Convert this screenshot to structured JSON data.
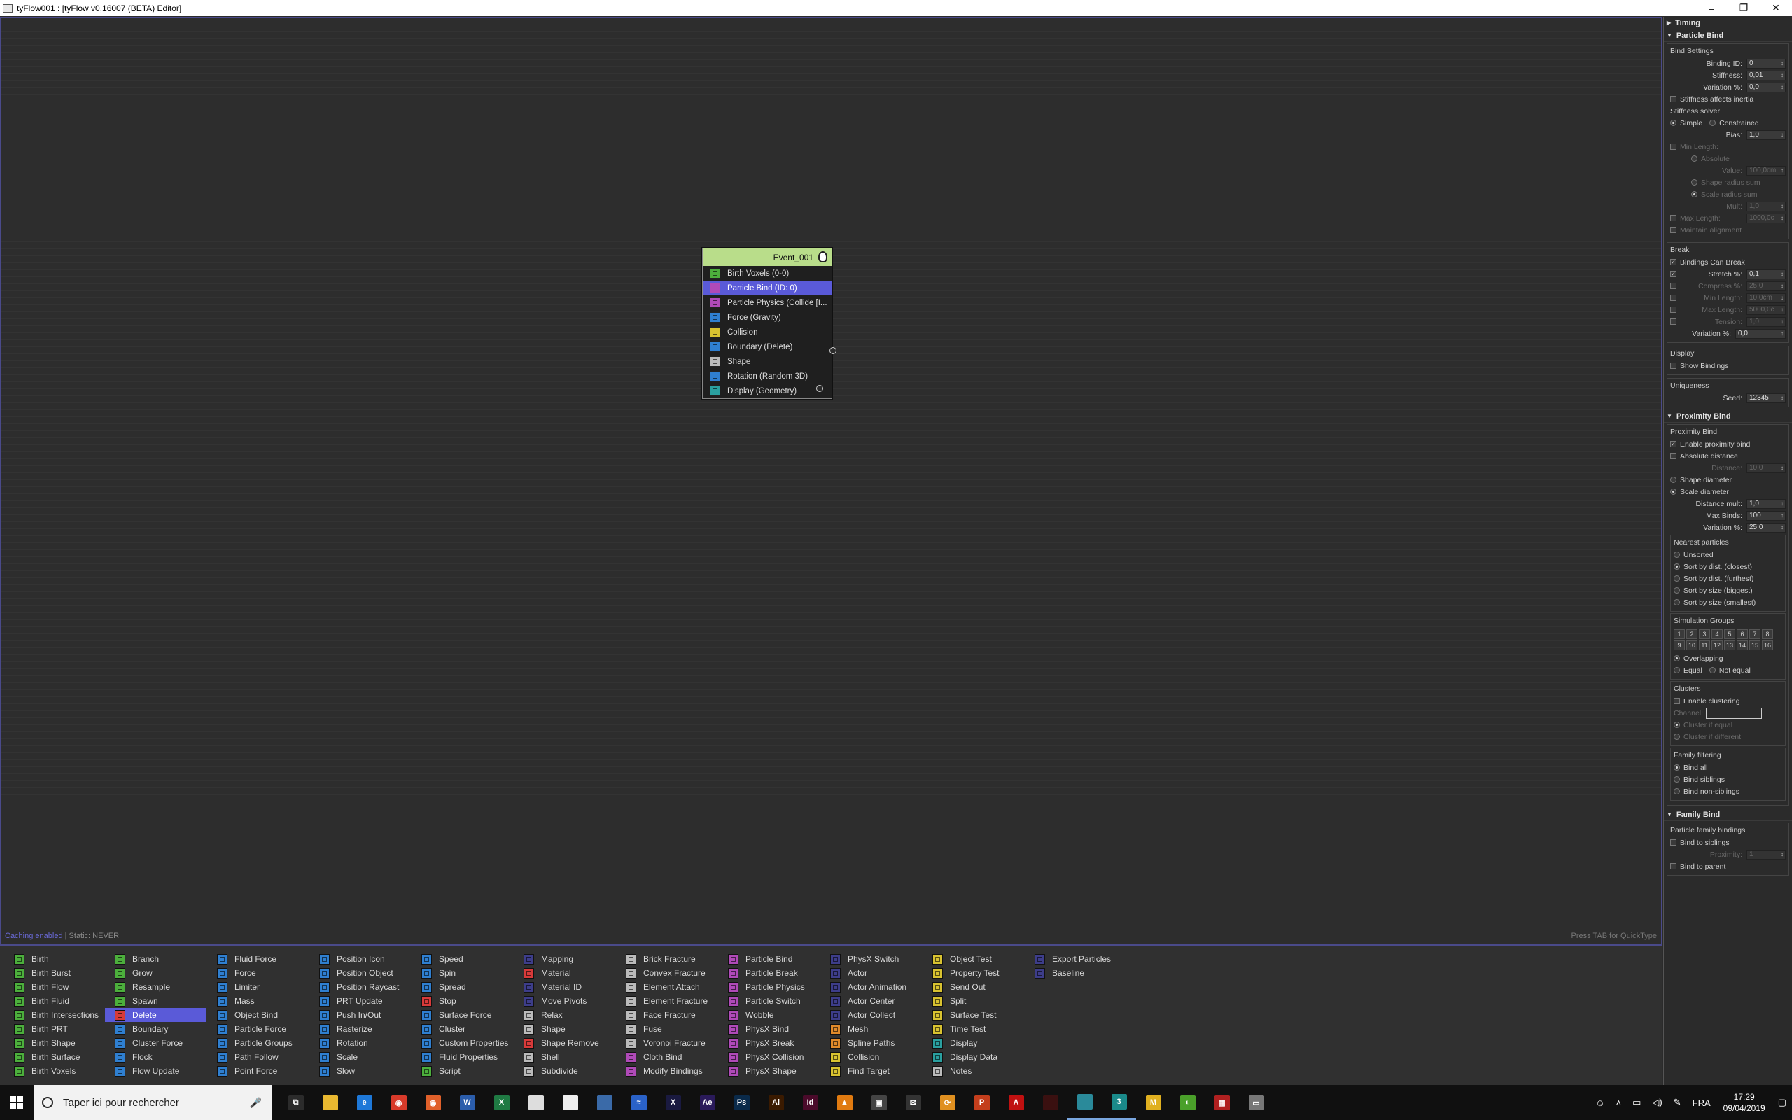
{
  "window": {
    "title": "tyFlow001 : [tyFlow v0,16007 (BETA) Editor]",
    "controls": [
      "–",
      "❐",
      "✕"
    ]
  },
  "canvas": {
    "status_caching": "Caching enabled",
    "status_static": " | Static: NEVER",
    "hint": "Press TAB for QuickType"
  },
  "event": {
    "name": "Event_001",
    "operators": [
      {
        "label": "Birth Voxels (0-0)",
        "color": "c-g",
        "icon": "birth-icon"
      },
      {
        "label": "Particle Bind (ID: 0)",
        "color": "c-p",
        "icon": "bind-icon",
        "selected": true
      },
      {
        "label": "Particle Physics (Collide [I...",
        "color": "c-p",
        "icon": "physics-icon"
      },
      {
        "label": "Force (Gravity)",
        "color": "c-b",
        "icon": "force-icon"
      },
      {
        "label": "Collision",
        "color": "c-y",
        "icon": "collision-icon"
      },
      {
        "label": "Boundary (Delete)",
        "color": "c-b",
        "icon": "boundary-icon"
      },
      {
        "label": "Shape",
        "color": "c-w",
        "icon": "shape-icon"
      },
      {
        "label": "Rotation (Random 3D)",
        "color": "c-b",
        "icon": "rotation-icon"
      },
      {
        "label": "Display (Geometry)",
        "color": "c-t",
        "icon": "display-icon"
      }
    ]
  },
  "rollouts": {
    "timing": "Timing",
    "particle_bind": "Particle Bind",
    "proximity_bind": "Proximity Bind",
    "family_bind": "Family Bind"
  },
  "pb": {
    "bind_settings": "Bind Settings",
    "binding_id_label": "Binding ID:",
    "binding_id": "0",
    "stiffness_label": "Stiffness:",
    "stiffness": "0,01",
    "variation_label": "Variation %:",
    "variation": "0,0",
    "stiffness_inertia": "Stiffness affects inertia",
    "stiffness_solver": "Stiffness solver",
    "simple": "Simple",
    "constrained": "Constrained",
    "bias_label": "Bias:",
    "bias": "1,0",
    "min_length": "Min Length:",
    "absolute": "Absolute",
    "value_label": "Value:",
    "value": "100,0cm",
    "shape_radius_sum": "Shape radius sum",
    "scale_radius_sum": "Scale radius sum",
    "mult_label": "Mult:",
    "mult": "1,0",
    "max_length_label": "Max Length:",
    "max_length": "1000,0c",
    "maintain_alignment": "Maintain alignment",
    "break": "Break",
    "bindings_can_break": "Bindings Can Break",
    "stretch_label": "Stretch %:",
    "stretch": "0,1",
    "compress_label": "Compress %:",
    "compress": "25,0",
    "minl_label": "Min Length:",
    "minl": "10,0cm",
    "maxl_label": "Max Length:",
    "maxl": "5000,0c",
    "tension_label": "Tension:",
    "tension": "1,0",
    "variation2_label": "Variation %:",
    "variation2": "0,0",
    "display": "Display",
    "show_bindings": "Show Bindings",
    "uniqueness": "Uniqueness",
    "seed_label": "Seed:",
    "seed": "12345"
  },
  "prox": {
    "group": "Proximity Bind",
    "enable": "Enable proximity bind",
    "absolute_distance": "Absolute distance",
    "distance_label": "Distance:",
    "distance": "10,0",
    "shape_diameter": "Shape diameter",
    "scale_diameter": "Scale diameter",
    "dist_mult_label": "Distance mult:",
    "dist_mult": "1,0",
    "max_binds_label": "Max Binds:",
    "max_binds": "100",
    "variation_label": "Variation %:",
    "variation": "25,0",
    "nearest": "Nearest particles",
    "unsorted": "Unsorted",
    "sort_closest": "Sort by dist. (closest)",
    "sort_furthest": "Sort by dist. (furthest)",
    "sort_biggest": "Sort by size (biggest)",
    "sort_smallest": "Sort by size (smallest)",
    "sim_groups": "Simulation Groups",
    "groups": [
      "1",
      "2",
      "3",
      "4",
      "5",
      "6",
      "7",
      "8",
      "9",
      "10",
      "11",
      "12",
      "13",
      "14",
      "15",
      "16"
    ],
    "overlapping": "Overlapping",
    "equal": "Equal",
    "not_equal": "Not equal",
    "clusters": "Clusters",
    "enable_clustering": "Enable clustering",
    "channel_label": "Channel:",
    "cluster_equal": "Cluster if equal",
    "cluster_different": "Cluster if different",
    "family_filtering": "Family filtering",
    "bind_all": "Bind all",
    "bind_siblings": "Bind siblings",
    "bind_non_siblings": "Bind non-siblings"
  },
  "family": {
    "group": "Particle family bindings",
    "bind_to_siblings": "Bind to siblings",
    "proximity_label": "Proximity:",
    "proximity": "1",
    "bind_to_parent": "Bind to parent"
  },
  "palette": [
    [
      {
        "l": "Birth",
        "c": "c-g"
      },
      {
        "l": "Birth Burst",
        "c": "c-g"
      },
      {
        "l": "Birth Flow",
        "c": "c-g"
      },
      {
        "l": "Birth Fluid",
        "c": "c-g"
      },
      {
        "l": "Birth Intersections",
        "c": "c-g"
      },
      {
        "l": "Birth PRT",
        "c": "c-g"
      },
      {
        "l": "Birth Shape",
        "c": "c-g"
      },
      {
        "l": "Birth Surface",
        "c": "c-g"
      },
      {
        "l": "Birth Voxels",
        "c": "c-g"
      }
    ],
    [
      {
        "l": "Branch",
        "c": "c-g"
      },
      {
        "l": "Grow",
        "c": "c-g"
      },
      {
        "l": "Resample",
        "c": "c-g"
      },
      {
        "l": "Spawn",
        "c": "c-g"
      },
      {
        "l": "Delete",
        "c": "c-r",
        "sel": true
      },
      {
        "l": "Boundary",
        "c": "c-b"
      },
      {
        "l": "Cluster Force",
        "c": "c-b"
      },
      {
        "l": "Flock",
        "c": "c-b"
      },
      {
        "l": "Flow Update",
        "c": "c-b"
      }
    ],
    [
      {
        "l": "Fluid Force",
        "c": "c-b"
      },
      {
        "l": "Force",
        "c": "c-b"
      },
      {
        "l": "Limiter",
        "c": "c-b"
      },
      {
        "l": "Mass",
        "c": "c-b"
      },
      {
        "l": "Object Bind",
        "c": "c-b"
      },
      {
        "l": "Particle Force",
        "c": "c-b"
      },
      {
        "l": "Particle Groups",
        "c": "c-b"
      },
      {
        "l": "Path Follow",
        "c": "c-b"
      },
      {
        "l": "Point Force",
        "c": "c-b"
      }
    ],
    [
      {
        "l": "Position Icon",
        "c": "c-b"
      },
      {
        "l": "Position Object",
        "c": "c-b"
      },
      {
        "l": "Position Raycast",
        "c": "c-b"
      },
      {
        "l": "PRT Update",
        "c": "c-b"
      },
      {
        "l": "Push In/Out",
        "c": "c-b"
      },
      {
        "l": "Rasterize",
        "c": "c-b"
      },
      {
        "l": "Rotation",
        "c": "c-b"
      },
      {
        "l": "Scale",
        "c": "c-b"
      },
      {
        "l": "Slow",
        "c": "c-b"
      }
    ],
    [
      {
        "l": "Speed",
        "c": "c-b"
      },
      {
        "l": "Spin",
        "c": "c-b"
      },
      {
        "l": "Spread",
        "c": "c-b"
      },
      {
        "l": "Stop",
        "c": "c-r"
      },
      {
        "l": "Surface Force",
        "c": "c-b"
      },
      {
        "l": "Cluster",
        "c": "c-b"
      },
      {
        "l": "Custom Properties",
        "c": "c-b"
      },
      {
        "l": "Fluid Properties",
        "c": "c-b"
      },
      {
        "l": "Script",
        "c": "c-g"
      }
    ],
    [
      {
        "l": "Mapping",
        "c": "c-n"
      },
      {
        "l": "Material",
        "c": "c-r"
      },
      {
        "l": "Material ID",
        "c": "c-n"
      },
      {
        "l": "Move Pivots",
        "c": "c-n"
      },
      {
        "l": "Relax",
        "c": "c-w"
      },
      {
        "l": "Shape",
        "c": "c-w"
      },
      {
        "l": "Shape Remove",
        "c": "c-r"
      },
      {
        "l": "Shell",
        "c": "c-w"
      },
      {
        "l": "Subdivide",
        "c": "c-w"
      }
    ],
    [
      {
        "l": "Brick Fracture",
        "c": "c-w"
      },
      {
        "l": "Convex Fracture",
        "c": "c-w"
      },
      {
        "l": "Element Attach",
        "c": "c-w"
      },
      {
        "l": "Element Fracture",
        "c": "c-w"
      },
      {
        "l": "Face Fracture",
        "c": "c-w"
      },
      {
        "l": "Fuse",
        "c": "c-w"
      },
      {
        "l": "Voronoi Fracture",
        "c": "c-w"
      },
      {
        "l": "Cloth Bind",
        "c": "c-p"
      },
      {
        "l": "Modify Bindings",
        "c": "c-p"
      }
    ],
    [
      {
        "l": "Particle Bind",
        "c": "c-p"
      },
      {
        "l": "Particle Break",
        "c": "c-p"
      },
      {
        "l": "Particle Physics",
        "c": "c-p"
      },
      {
        "l": "Particle Switch",
        "c": "c-p"
      },
      {
        "l": "Wobble",
        "c": "c-p"
      },
      {
        "l": "PhysX Bind",
        "c": "c-p"
      },
      {
        "l": "PhysX Break",
        "c": "c-p"
      },
      {
        "l": "PhysX Collision",
        "c": "c-p"
      },
      {
        "l": "PhysX Shape",
        "c": "c-p"
      }
    ],
    [
      {
        "l": "PhysX Switch",
        "c": "c-n"
      },
      {
        "l": "Actor",
        "c": "c-n"
      },
      {
        "l": "Actor Animation",
        "c": "c-n"
      },
      {
        "l": "Actor Center",
        "c": "c-n"
      },
      {
        "l": "Actor Collect",
        "c": "c-n"
      },
      {
        "l": "Mesh",
        "c": "c-o"
      },
      {
        "l": "Spline Paths",
        "c": "c-o"
      },
      {
        "l": "Collision",
        "c": "c-y"
      },
      {
        "l": "Find Target",
        "c": "c-y"
      }
    ],
    [
      {
        "l": "Object Test",
        "c": "c-y"
      },
      {
        "l": "Property Test",
        "c": "c-y"
      },
      {
        "l": "Send Out",
        "c": "c-y"
      },
      {
        "l": "Split",
        "c": "c-y"
      },
      {
        "l": "Surface Test",
        "c": "c-y"
      },
      {
        "l": "Time Test",
        "c": "c-y"
      },
      {
        "l": "Display",
        "c": "c-t"
      },
      {
        "l": "Display Data",
        "c": "c-t"
      },
      {
        "l": "Notes",
        "c": "c-w"
      }
    ],
    [
      {
        "l": "Export Particles",
        "c": "c-n"
      },
      {
        "l": "Baseline",
        "c": "c-n"
      }
    ]
  ],
  "taskbar": {
    "search_placeholder": "Taper ici pour rechercher",
    "apps": [
      {
        "name": "task-view-app",
        "c": "#2b2b2b",
        "t": "⧉"
      },
      {
        "name": "file-explorer-app",
        "c": "#e8b830",
        "t": ""
      },
      {
        "name": "edge-app",
        "c": "#1e78d8",
        "t": "e"
      },
      {
        "name": "chrome-app",
        "c": "#d83a2a",
        "t": "◉"
      },
      {
        "name": "firefox-app",
        "c": "#e0602a",
        "t": "◉"
      },
      {
        "name": "word-app",
        "c": "#2b5dab",
        "t": "W"
      },
      {
        "name": "excel-app",
        "c": "#1f7a43",
        "t": "X"
      },
      {
        "name": "notepad-app",
        "c": "#ddd",
        "t": ""
      },
      {
        "name": "document-app",
        "c": "#eee",
        "t": ""
      },
      {
        "name": "tool-app",
        "c": "#3a6aa8",
        "t": ""
      },
      {
        "name": "blue-app",
        "c": "#2a62c8",
        "t": "≈"
      },
      {
        "name": "xsplit-app",
        "c": "#1a1a40",
        "t": "X"
      },
      {
        "name": "after-effects-app",
        "c": "#2a1a5a",
        "t": "Ae"
      },
      {
        "name": "photoshop-app",
        "c": "#0a2a4a",
        "t": "Ps"
      },
      {
        "name": "illustrator-app",
        "c": "#3a1a00",
        "t": "Ai"
      },
      {
        "name": "indesign-app",
        "c": "#4a0a2a",
        "t": "Id"
      },
      {
        "name": "vlc-app",
        "c": "#e07a10",
        "t": "▲"
      },
      {
        "name": "photos-app",
        "c": "#444",
        "t": "▣"
      },
      {
        "name": "mail-app",
        "c": "#333",
        "t": "✉"
      },
      {
        "name": "sync-app",
        "c": "#e09020",
        "t": "⟳"
      },
      {
        "name": "powerpoint-app",
        "c": "#c43e1c",
        "t": "P"
      },
      {
        "name": "acrobat-app",
        "c": "#c01010",
        "t": "A"
      },
      {
        "name": "dark-app",
        "c": "#3a1010",
        "t": ""
      },
      {
        "name": "tyflow-app",
        "c": "#2a8a9a",
        "t": "",
        "active": true
      },
      {
        "name": "3dsmax-app",
        "c": "#1a8a8a",
        "t": "3",
        "active": true
      },
      {
        "name": "m-app",
        "c": "#e0b020",
        "t": "M"
      },
      {
        "name": "green-app",
        "c": "#4aa02a",
        "t": "◐"
      },
      {
        "name": "red-app",
        "c": "#b02020",
        "t": "▦"
      },
      {
        "name": "drive-app",
        "c": "#777",
        "t": "▭"
      }
    ],
    "lang": "FRA",
    "time": "17:29",
    "date": "09/04/2019"
  }
}
